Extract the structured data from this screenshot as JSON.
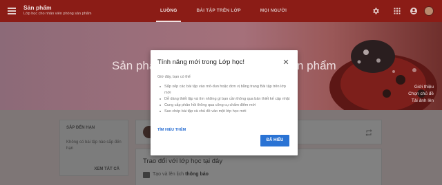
{
  "appbar": {
    "title": "Sản phẩm",
    "subtitle": "Lớp học cho nhân viên phòng sản phẩm",
    "tabs": [
      {
        "label": "LUỒNG",
        "active": true
      },
      {
        "label": "BÀI TẬP TRÊN LỚP",
        "active": false
      },
      {
        "label": "MỌI NGƯỜI",
        "active": false
      }
    ],
    "icons": [
      "menu-icon",
      "gear-icon",
      "apps-icon",
      "account-icon"
    ]
  },
  "banner": {
    "title_left": "Sản phẩ",
    "title_right": "n phẩm",
    "links": [
      "Giới thiệu",
      "Chọn chủ đề",
      "Tải ảnh lên"
    ]
  },
  "upcoming": {
    "title": "SẮP ĐẾN HẠN",
    "text": "Không có bài tập nào sắp đến hạn",
    "view_all": "XEM TẤT CẢ"
  },
  "stream": {
    "title": "Trao đổi với lớp học tại đây",
    "hint_prefix": "Tạo và lên lịch ",
    "hint_bold": "thông báo"
  },
  "dialog": {
    "title": "Tính năng mới trong Lớp học!",
    "intro": "Giờ đây, bạn có thể",
    "features": [
      "Sắp xếp các bài tập vào mô-đun hoặc đơn vị bằng trang Bài tập trên lớp mới",
      "Dễ dàng thiết lập và tìm những gì bạn cần thông qua bản thiết kế cập nhật",
      "Cung cấp phản hồi thông qua công cụ chấm điểm mới",
      "Sao chép bài tập và chủ đề vào một lớp học mới"
    ],
    "learn_more": "TÌM HIỂU THÊM",
    "confirm": "ĐÃ HIỂU"
  },
  "colors": {
    "appbar": "#8b1c16",
    "accent_blue": "#2a73d4",
    "dim_overlay": "#7a7a7a"
  }
}
